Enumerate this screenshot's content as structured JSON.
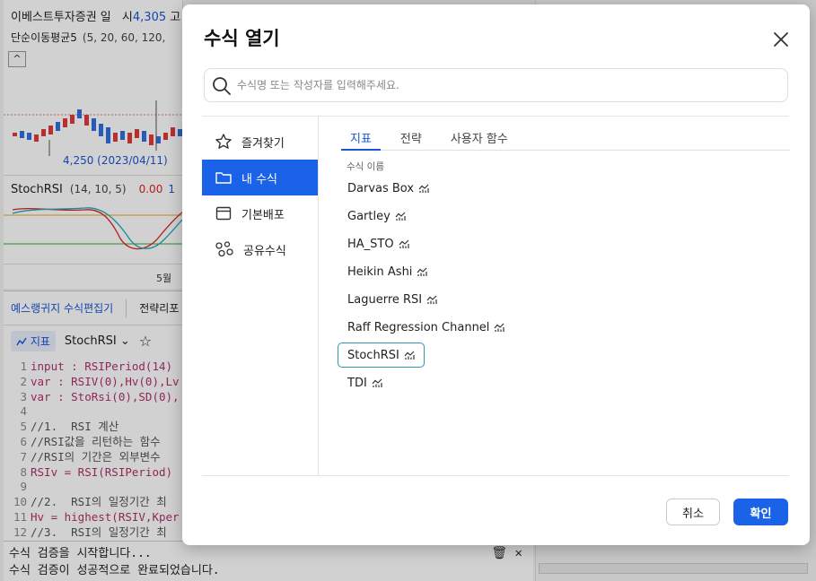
{
  "background": {
    "chart": {
      "title": "이베스트투자증권 일",
      "price_label": "시",
      "price_value": "4,305",
      "price_suffix": "고",
      "ma_label": "단순이동평균5",
      "ma_params": "(5, 20, 60, 120,",
      "collapse_symbol": "^",
      "low_annotation": "4,250 (2023/04/11)",
      "stoch_label": "StochRSI",
      "stoch_params": "(14, 10, 5)",
      "stoch_value_1": "0.00",
      "stoch_value_2": "1",
      "month_label": "5월"
    },
    "editor": {
      "tabs": [
        "예스랭귀지 수식편집기",
        "전략리포"
      ],
      "indicator_chip": "지표",
      "formula_name": "StochRSI",
      "dropdown_symbol": "⌄",
      "star_symbol": "☆",
      "code_lines": [
        {
          "n": "1",
          "text": "input : RSIPeriod(14)",
          "type": "code"
        },
        {
          "n": "2",
          "text": "var : RSIV(0),Hv(0),Lv",
          "type": "code"
        },
        {
          "n": "3",
          "text": "var : StoRsi(0),SD(0),",
          "type": "code"
        },
        {
          "n": "4",
          "text": "",
          "type": "code"
        },
        {
          "n": "5",
          "text": "//1.  RSI 계산",
          "type": "cmt"
        },
        {
          "n": "6",
          "text": "//RSI값을 리턴하는 함수",
          "type": "cmt"
        },
        {
          "n": "7",
          "text": "//RSI의 기간은 외부변수",
          "type": "cmt"
        },
        {
          "n": "8",
          "text": "RSIv = RSI(RSIPeriod)",
          "type": "code"
        },
        {
          "n": "9",
          "text": "",
          "type": "code"
        },
        {
          "n": "10",
          "text": "//2.  RSI의 일정기간 최",
          "type": "cmt"
        },
        {
          "n": "11",
          "text": "Hv = highest(RSIV,Kper",
          "type": "code"
        },
        {
          "n": "12",
          "text": "//3.  RSI의 일정기간 최",
          "type": "cmt"
        }
      ],
      "console_lines": [
        "수식 검증을 시작합니다...",
        "수식 검증이 성공적으로 완료되었습니다."
      ],
      "console_icons": "🗑 ✕"
    }
  },
  "modal": {
    "title": "수식 열기",
    "search_placeholder": "수식명 또는 작성자를 입력해주세요.",
    "sidebar": [
      {
        "label": "즐겨찾기",
        "icon": "star-icon",
        "active": false
      },
      {
        "label": "내 수식",
        "icon": "folder-icon",
        "active": true
      },
      {
        "label": "기본배포",
        "icon": "window-icon",
        "active": false
      },
      {
        "label": "공유수식",
        "icon": "share-icon",
        "active": false
      }
    ],
    "tabs": [
      {
        "label": "지표",
        "active": true
      },
      {
        "label": "전략",
        "active": false
      },
      {
        "label": "사용자 함수",
        "active": false
      }
    ],
    "column_header": "수식 이름",
    "formulas": [
      {
        "name": "Darvas Box",
        "selected": false
      },
      {
        "name": "Gartley",
        "selected": false
      },
      {
        "name": "HA_STO",
        "selected": false
      },
      {
        "name": "Heikin Ashi",
        "selected": false
      },
      {
        "name": "Laguerre RSI",
        "selected": false
      },
      {
        "name": "Raff Regression Channel",
        "selected": false
      },
      {
        "name": "StochRSI",
        "selected": true
      },
      {
        "name": "TDI",
        "selected": false
      }
    ],
    "cancel_label": "취소",
    "ok_label": "확인",
    "colors": {
      "accent": "#1a63e8",
      "selected_border": "#2b9bb0",
      "candle_up": "#e03a3a",
      "candle_down": "#2f6fe0"
    }
  }
}
